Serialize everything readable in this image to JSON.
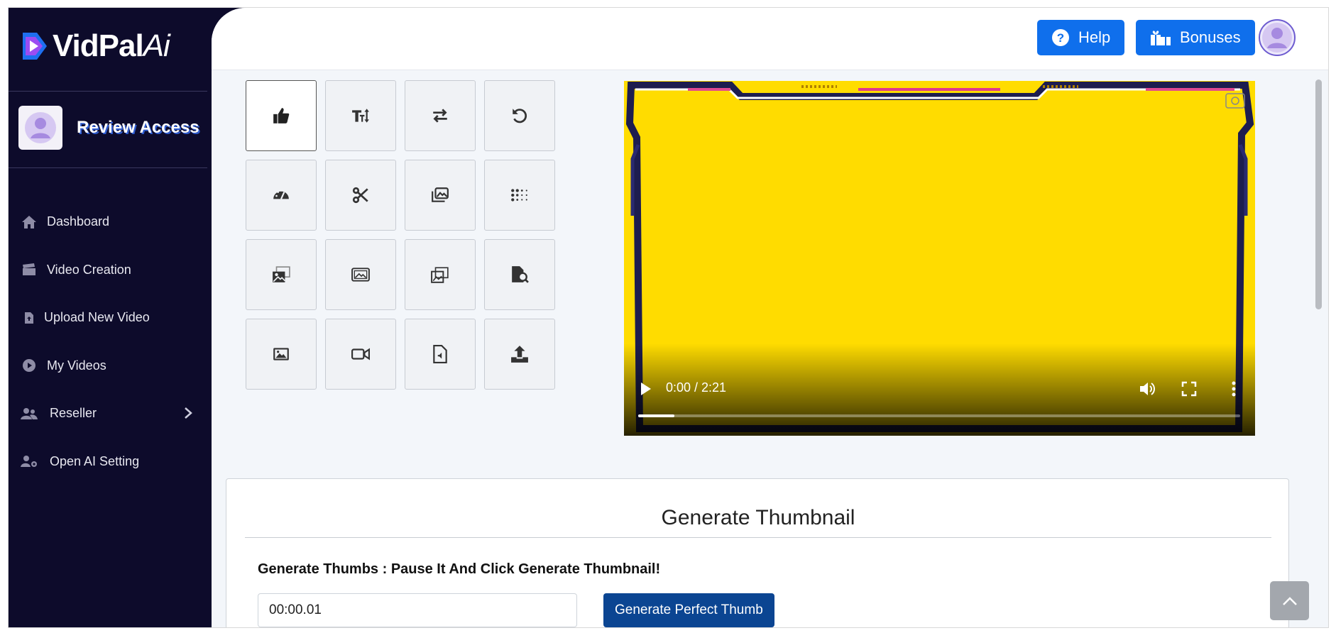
{
  "app": {
    "brand_main": "VidPal",
    "brand_ai": "Ai"
  },
  "sidebar": {
    "profile_name": "Review Access",
    "items": [
      {
        "label": "Dashboard",
        "icon": "home-icon"
      },
      {
        "label": "Video Creation",
        "icon": "clapperboard-icon"
      },
      {
        "label": "Upload New Video",
        "icon": "file-upload-icon"
      },
      {
        "label": "My Videos",
        "icon": "play-circle-icon"
      },
      {
        "label": "Reseller",
        "icon": "users-icon"
      },
      {
        "label": "Open AI Setting",
        "icon": "user-gear-icon"
      }
    ]
  },
  "header": {
    "help_label": "Help",
    "bonuses_label": "Bonuses"
  },
  "tools": [
    {
      "icon": "thumbs-up-icon"
    },
    {
      "icon": "text-size-icon"
    },
    {
      "icon": "swap-arrows-icon"
    },
    {
      "icon": "undo-icon"
    },
    {
      "icon": "gauge-icon"
    },
    {
      "icon": "scissors-icon"
    },
    {
      "icon": "image-stack-icon"
    },
    {
      "icon": "dots-grid-icon"
    },
    {
      "icon": "images-icon"
    },
    {
      "icon": "image-frame-icon"
    },
    {
      "icon": "gallery-icon"
    },
    {
      "icon": "file-search-icon"
    },
    {
      "icon": "image-icon"
    },
    {
      "icon": "video-camera-icon"
    },
    {
      "icon": "audio-file-icon"
    },
    {
      "icon": "upload-icon"
    }
  ],
  "player": {
    "time": "0:00 / 2:21",
    "progress": 0.06
  },
  "thumbnail": {
    "title": "Generate Thumbnail",
    "instruction": "Generate Thumbs : Pause It And Click Generate Thumbnail!",
    "time_value": "00:00.01",
    "button_label": "Generate Perfect Thumb"
  },
  "colors": {
    "sidebar_bg": "#0d0b2b",
    "primary": "#0f6fec",
    "dark_button": "#0b4592",
    "video_bg": "#ffdc00"
  }
}
